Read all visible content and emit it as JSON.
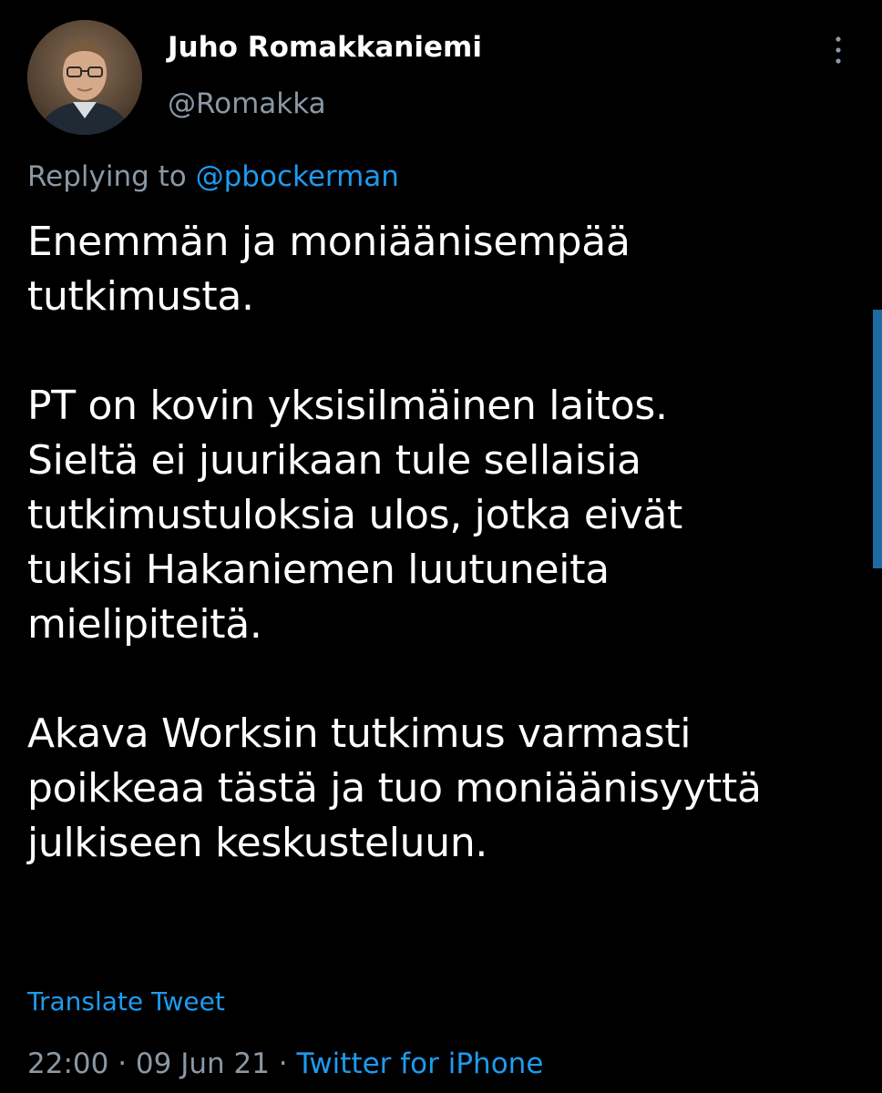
{
  "author": {
    "display_name": "Juho Romakkaniemi",
    "handle": "@Romakka",
    "avatar_icon": "user-avatar-photo"
  },
  "reply": {
    "prefix": "Replying to ",
    "to": "@pbockerman"
  },
  "tweet": {
    "paragraphs": [
      [
        "Enemmän ja moniäänisempää",
        "tutkimusta."
      ],
      [
        "PT on kovin yksisilmäinen laitos.",
        "Sieltä ei juurikaan tule sellaisia",
        "tutkimustuloksia ulos, jotka eivät",
        "tukisi Hakaniemen luutuneita",
        "mielipiteitä."
      ],
      [
        "Akava Worksin tutkimus varmasti",
        "poikkeaa tästä ja tuo moniäänisyyttä",
        "julkiseen keskusteluun."
      ]
    ]
  },
  "translate_label": "Translate Tweet",
  "meta": {
    "time": "22:00",
    "separator": " · ",
    "date": "09 Jun 21",
    "source": "Twitter for iPhone"
  },
  "icons": {
    "more": "more-vertical-icon"
  },
  "colors": {
    "background": "#000000",
    "text": "#ffffff",
    "secondary": "#8b98a5",
    "link": "#1d9bf0"
  }
}
